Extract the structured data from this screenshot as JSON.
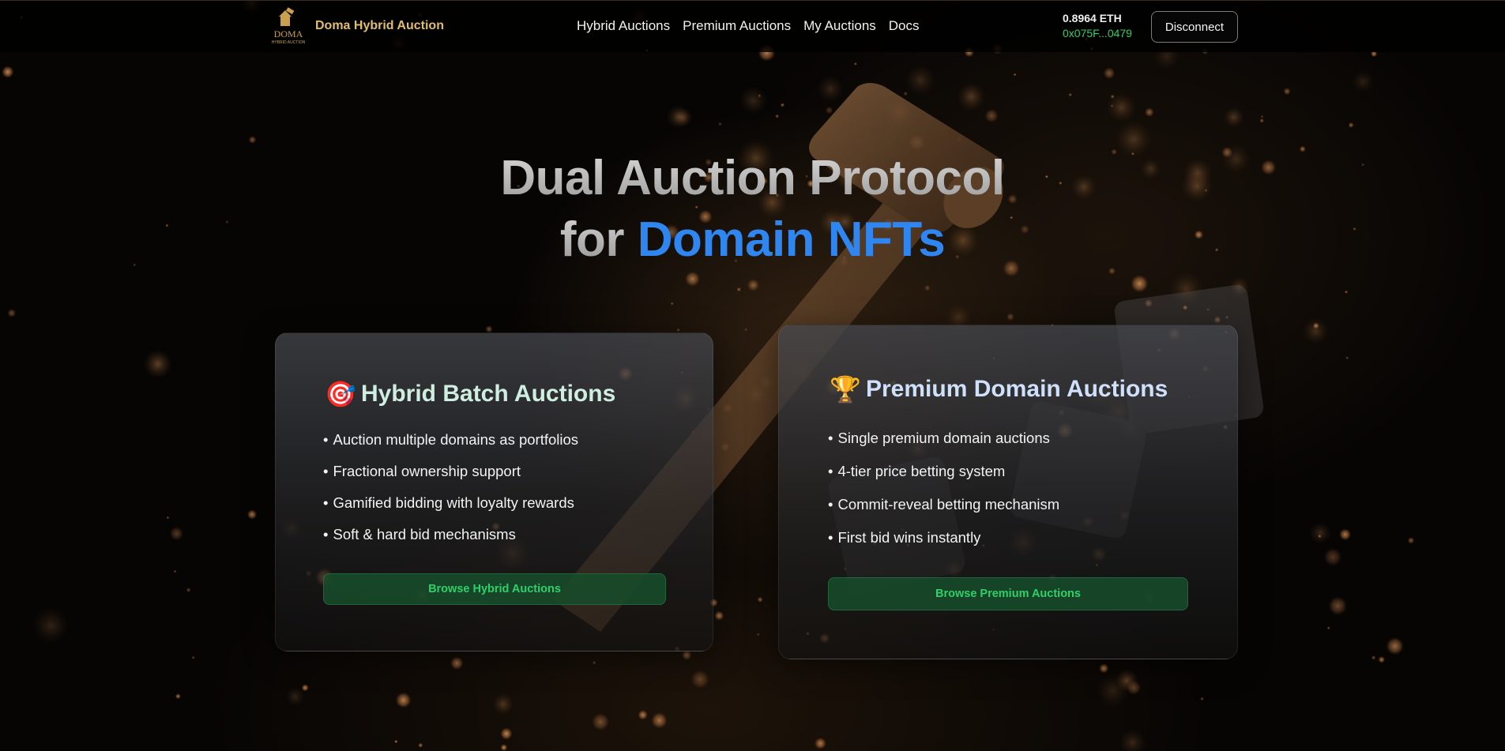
{
  "navbar": {
    "logo": {
      "icon": "gavel-house-logo-icon",
      "text": "DOMA",
      "subtext": "HYBRID AUCTION"
    },
    "brand_name": "Doma Hybrid Auction",
    "links": [
      {
        "label": "Hybrid Auctions"
      },
      {
        "label": "Premium Auctions"
      },
      {
        "label": "My Auctions"
      },
      {
        "label": "Docs"
      }
    ],
    "wallet": {
      "balance": "0.8964 ETH",
      "address": "0x075F...0479"
    },
    "disconnect_label": "Disconnect"
  },
  "hero": {
    "line1": "Dual Auction Protocol",
    "line2_prefix": "for",
    "line2_accent": "Domain NFTs"
  },
  "cards": {
    "hybrid": {
      "icon": "target-icon",
      "icon_glyph": "🎯",
      "title": "Hybrid Batch Auctions",
      "features": [
        "Auction multiple domains as portfolios",
        "Fractional ownership support",
        "Gamified bidding with loyalty rewards",
        "Soft & hard bid mechanisms"
      ],
      "button_label": "Browse Hybrid Auctions"
    },
    "premium": {
      "icon": "trophy-icon",
      "icon_glyph": "🏆",
      "title": "Premium Domain Auctions",
      "features": [
        "Single premium domain auctions",
        "4-tier price betting system",
        "Commit-reveal betting mechanism",
        "First bid wins instantly"
      ],
      "button_label": "Browse Premium Auctions"
    }
  },
  "colors": {
    "brand_gold": "#e2be6a",
    "accent_blue": "#2f86f0",
    "address_green": "#2fcf6a",
    "button_bg": "#184e2c"
  }
}
